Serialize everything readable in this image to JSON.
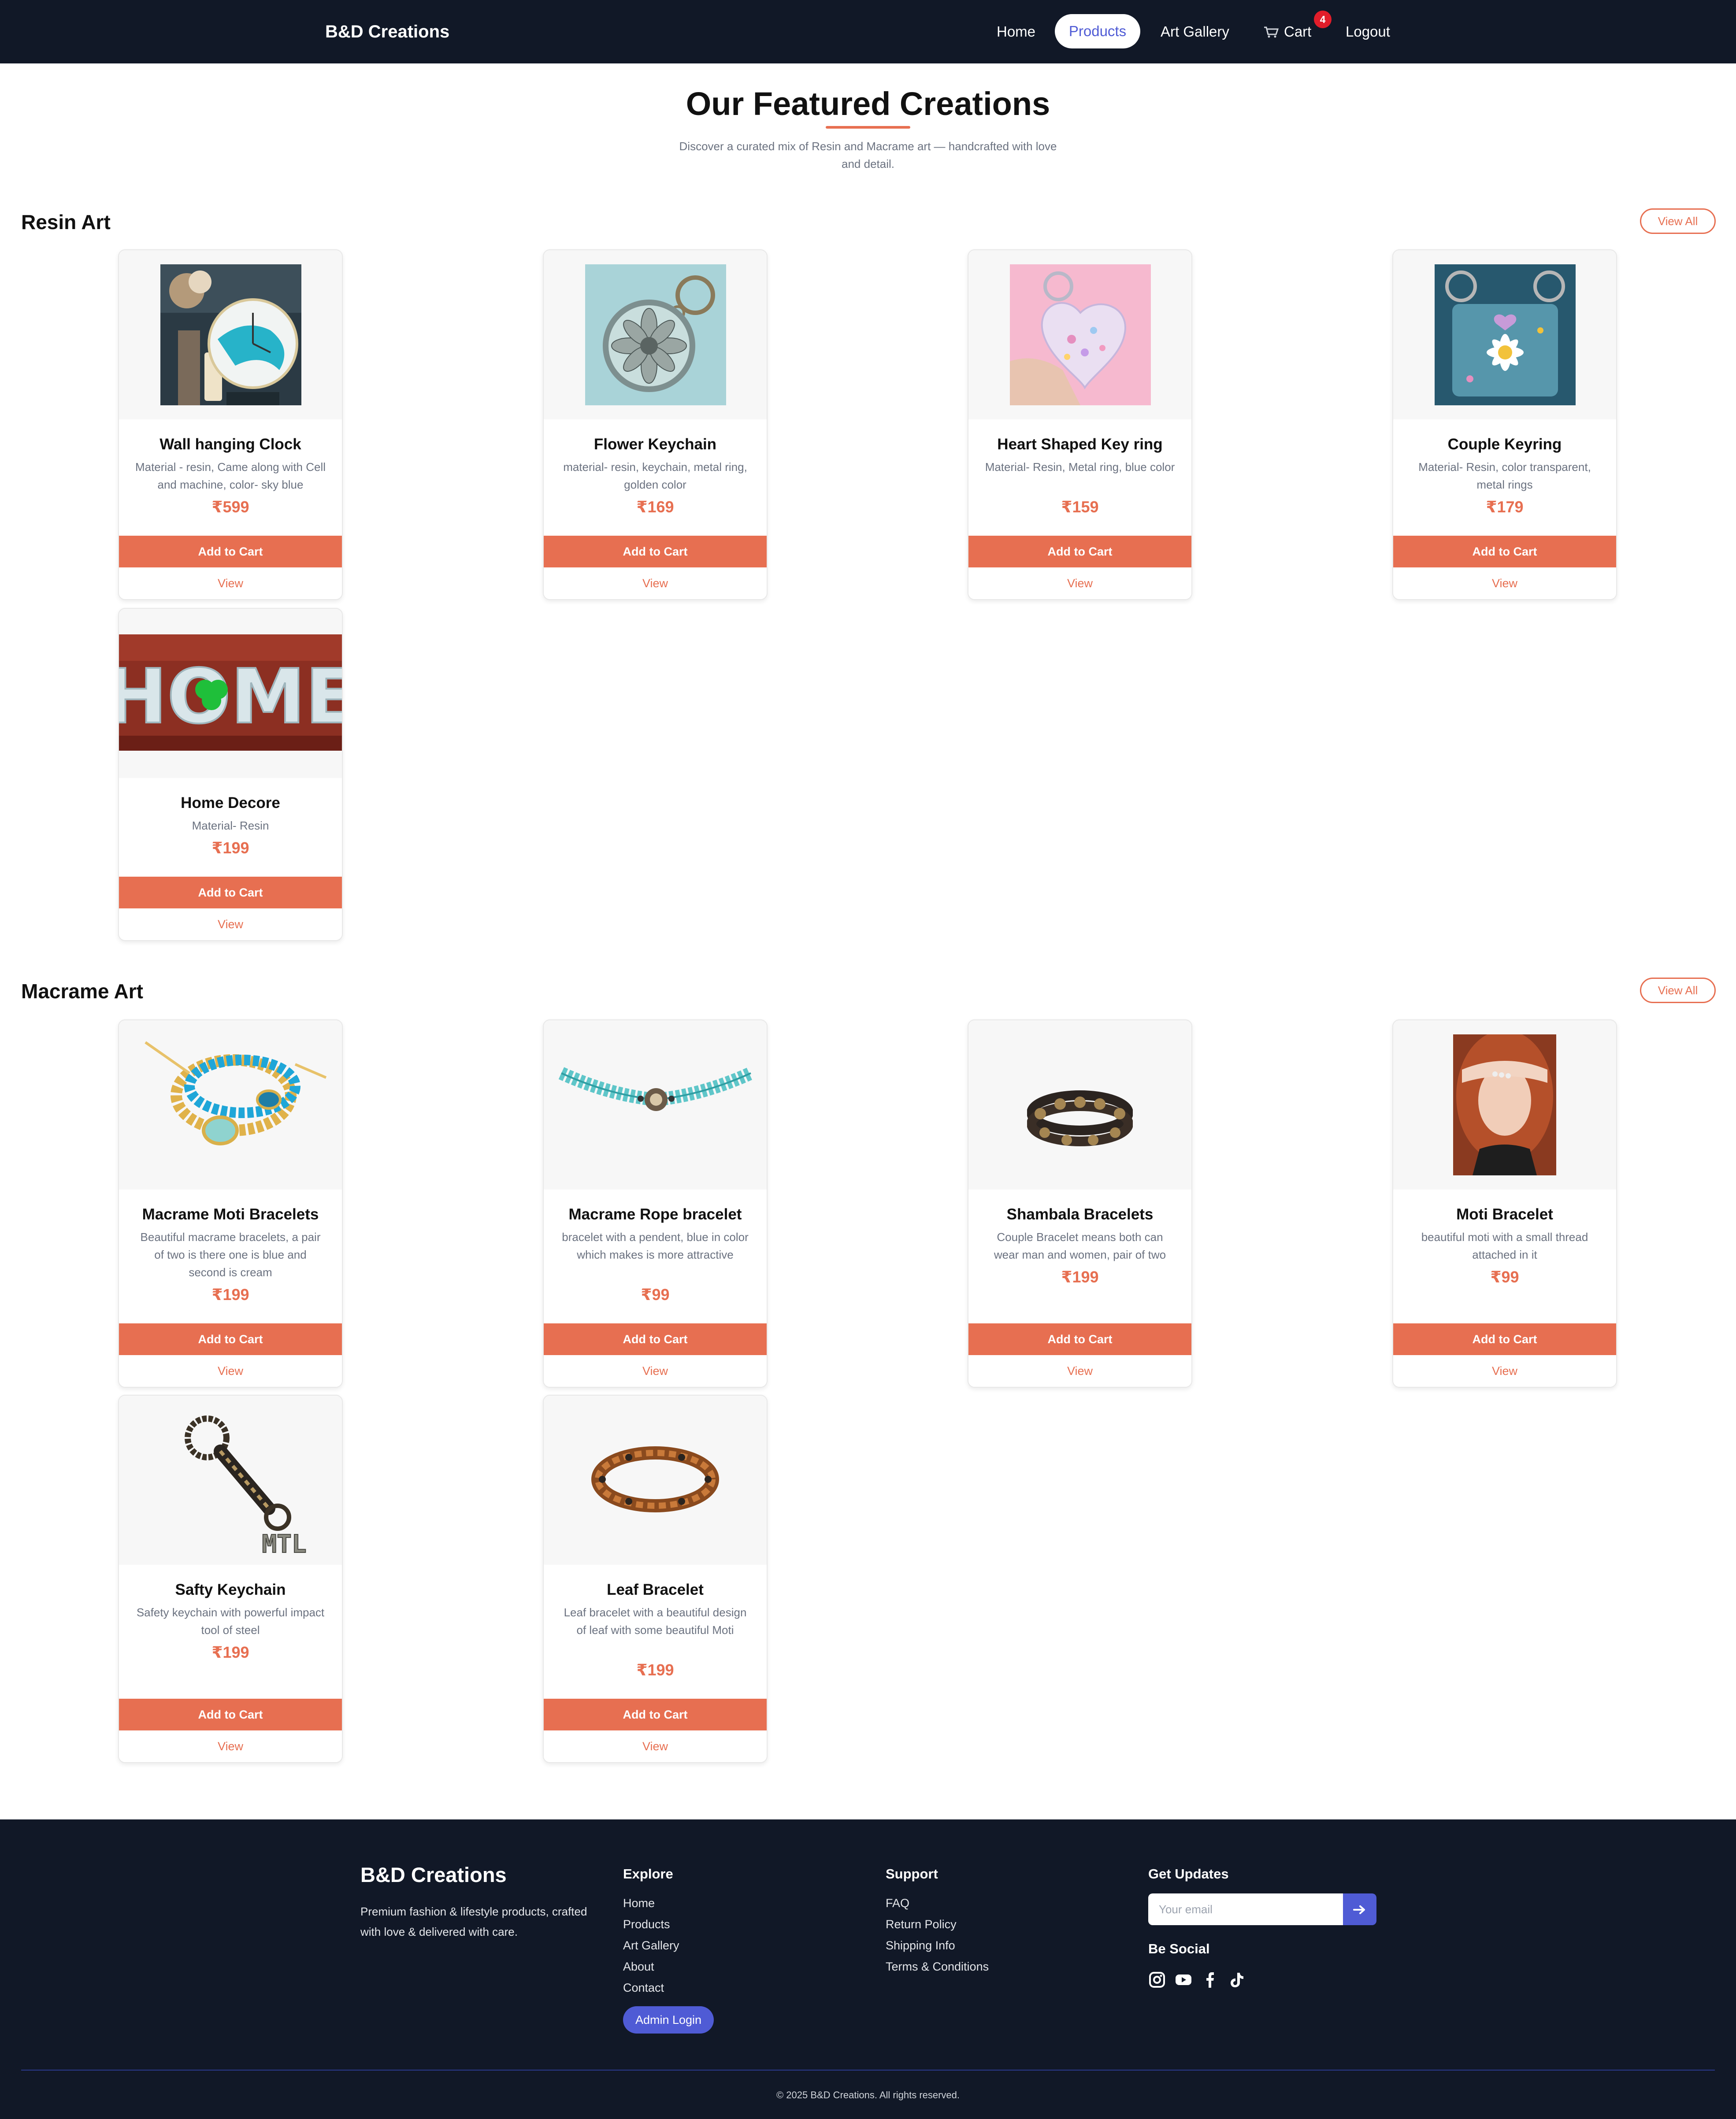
{
  "nav": {
    "brand": "B&D Creations",
    "links": [
      "Home",
      "Products",
      "Art Gallery",
      "Cart",
      "Logout"
    ],
    "cart_count": "4",
    "active": "Products"
  },
  "header": {
    "title": "Our Featured Creations",
    "subtitle": "Discover a curated mix of Resin and Macrame art — handcrafted with love and detail."
  },
  "sections": [
    {
      "title": "Resin Art",
      "view_all": "View All",
      "products": [
        {
          "name": "Wall hanging Clock",
          "desc": "Material - resin, Came along with Cell and machine, color- sky blue",
          "price": "₹599"
        },
        {
          "name": "Flower Keychain",
          "desc": "material- resin, keychain, metal ring, golden color",
          "price": "₹169"
        },
        {
          "name": "Heart Shaped Key ring",
          "desc": "Material- Resin, Metal ring, blue color",
          "price": "₹159"
        },
        {
          "name": "Couple Keyring",
          "desc": "Material- Resin, color transparent, metal rings",
          "price": "₹179"
        },
        {
          "name": "Home Decore",
          "desc": "Material- Resin",
          "price": "₹199"
        }
      ]
    },
    {
      "title": "Macrame Art",
      "view_all": "View All",
      "products": [
        {
          "name": "Macrame Moti Bracelets",
          "desc": "Beautiful macrame bracelets, a pair of two is there one is blue and second is cream",
          "price": "₹199"
        },
        {
          "name": "Macrame Rope bracelet",
          "desc": "bracelet with a pendent, blue in color which makes is more attractive",
          "price": "₹99"
        },
        {
          "name": "Shambala Bracelets",
          "desc": "Couple Bracelet means both can wear man and women, pair of two",
          "price": "₹199"
        },
        {
          "name": "Moti Bracelet",
          "desc": "beautiful moti with a small thread attached in it",
          "price": "₹99"
        },
        {
          "name": "Safty Keychain",
          "desc": "Safety keychain with powerful impact tool of steel",
          "price": "₹199"
        },
        {
          "name": "Leaf Bracelet",
          "desc": "Leaf bracelet with a beautiful design of leaf with some beautiful Moti",
          "price": "₹199"
        }
      ]
    }
  ],
  "card_buttons": {
    "add_to_cart": "Add to Cart",
    "view": "View"
  },
  "image_text": {
    "home_decor": "HOME",
    "safety_keychain": "MTL"
  },
  "footer": {
    "brand": "B&D Creations",
    "tagline": "Premium fashion & lifestyle products, crafted with love & delivered with care.",
    "explore": {
      "heading": "Explore",
      "links": [
        "Home",
        "Products",
        "Art Gallery",
        "About",
        "Contact"
      ],
      "admin_button": "Admin Login"
    },
    "support": {
      "heading": "Support",
      "links": [
        "FAQ",
        "Return Policy",
        "Shipping Info",
        "Terms & Conditions"
      ]
    },
    "updates": {
      "heading": "Get Updates",
      "email_placeholder": "Your email",
      "submit_icon": "arrow-right-icon"
    },
    "social": {
      "heading": "Be Social",
      "icons": [
        "instagram-icon",
        "youtube-icon",
        "facebook-icon",
        "tiktok-icon"
      ]
    },
    "copyright": "© 2025 B&D Creations. All rights reserved."
  },
  "colors": {
    "navy": "#111827",
    "accent": "#e76f51",
    "indigo": "#4f5bd5",
    "badge": "#e11d2a"
  }
}
